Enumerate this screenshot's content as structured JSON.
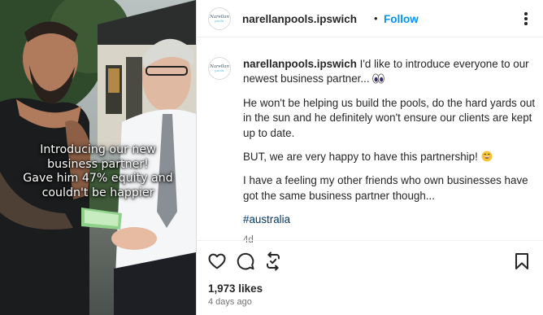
{
  "photo": {
    "overlay_lines": [
      "Introducing our new",
      "business partner!",
      "Gave him 47% equity and",
      "couldn't be happier"
    ]
  },
  "header": {
    "avatar_text_top": "Narellan",
    "avatar_text_bottom": "pools",
    "username": "narellanpools.ipswich",
    "separator": "•",
    "follow_label": "Follow"
  },
  "caption": {
    "username": "narellanpools.ipswich",
    "line1": "I'd like to introduce everyone to our newest business partner...",
    "para2": "He won't be helping us build the pools, do the hard yards out in the sun and he definitely won't ensure our clients are kept up to date.",
    "para3": "BUT, we are very happy to have this partnership!",
    "para4": "I have a feeling my other friends who own businesses have got the same business partner though...",
    "hashtag": "#australia",
    "age": "4d"
  },
  "footer": {
    "likes": "1,973 likes",
    "posted": "4 days ago"
  },
  "icons": {
    "eyes": "eyes-emoji",
    "smile": "grinning-emoji",
    "like": "heart-icon",
    "comment": "comment-icon",
    "share": "repost-icon",
    "save": "bookmark-icon",
    "more": "more-options-icon"
  },
  "colors": {
    "link_blue": "#0095f6",
    "hashtag": "#00376b",
    "secondary_text": "#737373"
  }
}
